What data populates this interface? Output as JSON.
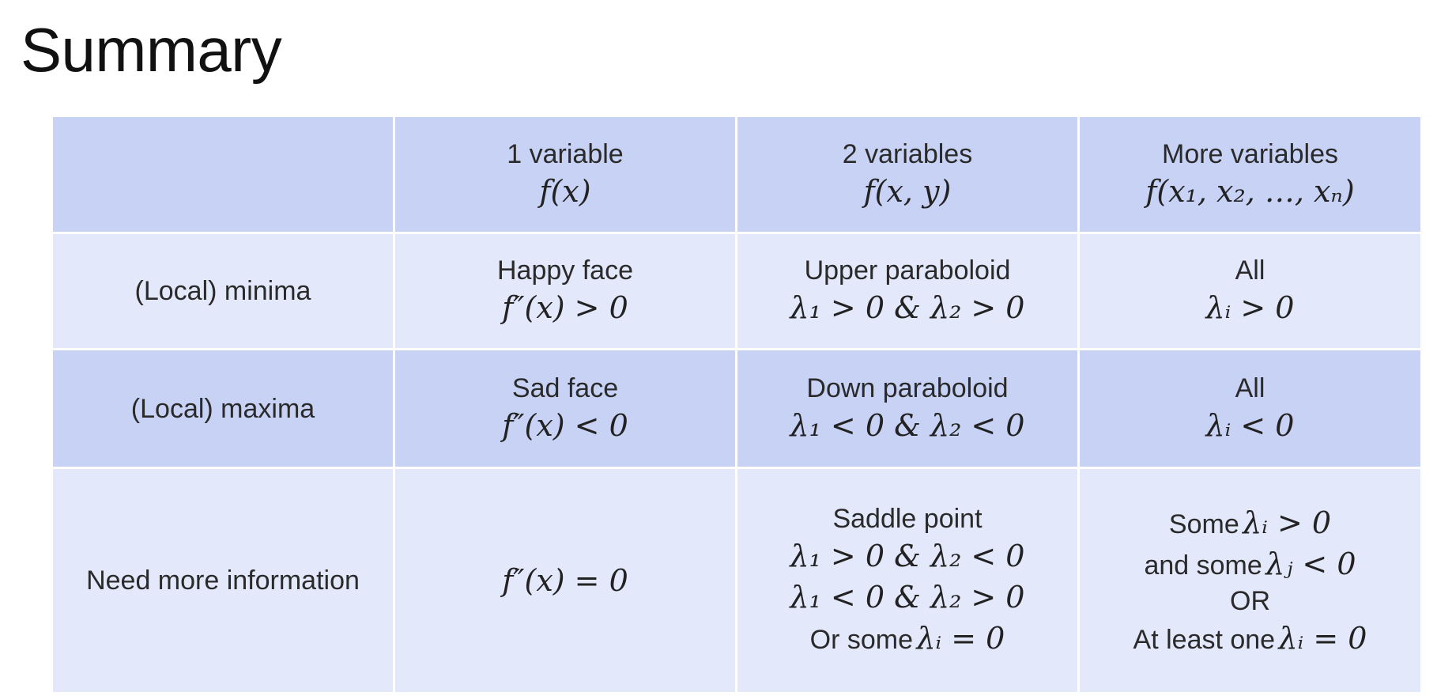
{
  "title": "Summary",
  "table": {
    "header": [
      "",
      "1 variable",
      "2 variables",
      "More variables"
    ],
    "header_formulas": [
      "",
      "f(x)",
      "f(x, y)",
      "f(x₁, x₂, …, xₙ)"
    ],
    "rows": [
      {
        "label": "(Local) minima",
        "c1": {
          "text": "Happy face",
          "math": "f″(x) > 0"
        },
        "c2": {
          "text": "Upper paraboloid",
          "math": "λ₁ > 0 & λ₂ > 0"
        },
        "c3": {
          "text": "All",
          "math": "λᵢ > 0"
        }
      },
      {
        "label": "(Local) maxima",
        "c1": {
          "text": "Sad face",
          "math": "f″(x) < 0"
        },
        "c2": {
          "text": "Down paraboloid",
          "math": "λ₁ < 0 & λ₂ < 0"
        },
        "c3": {
          "text": "All",
          "math": "λᵢ < 0"
        }
      },
      {
        "label": "Need more information",
        "c1": {
          "math": "f″(x) = 0"
        },
        "c2": {
          "text": "Saddle point",
          "math1": "λ₁ > 0 & λ₂ < 0",
          "math2": "λ₁ < 0 & λ₂ > 0",
          "or_text": "Or some",
          "or_math": "λᵢ = 0"
        },
        "c3": {
          "line1_text": "Some",
          "line1_math": "λᵢ > 0",
          "line2_text": "and some",
          "line2_math": "λⱼ < 0",
          "or": "OR",
          "line3_text": "At least one",
          "line3_math": "λᵢ = 0"
        }
      }
    ]
  },
  "colors": {
    "header_row": "#c7d2f5",
    "light_row": "#e3e8fb"
  }
}
